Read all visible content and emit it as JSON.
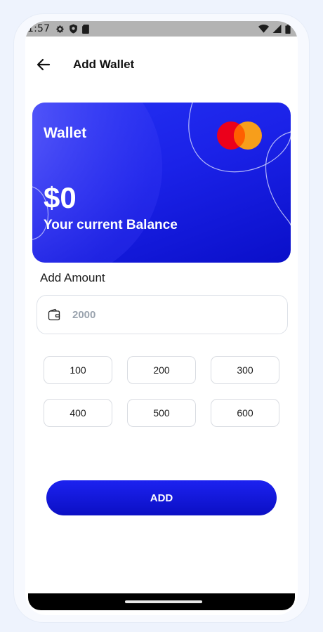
{
  "status_bar": {
    "time": "1:57",
    "left_icons": [
      "gear-icon",
      "shield-icon",
      "sd-card-icon"
    ],
    "right_icons": [
      "wifi-icon",
      "signal-icon",
      "battery-icon"
    ]
  },
  "header": {
    "title": "Add Wallet",
    "back_icon": "arrow-left-icon"
  },
  "card": {
    "label": "Wallet",
    "balance": "$0",
    "caption": "Your current Balance",
    "logo": "mastercard-logo",
    "colors": {
      "gradient_start": "#2431f3",
      "gradient_end": "#0a0fc9",
      "logo_red": "#eb001b",
      "logo_orange": "#f79e1b"
    }
  },
  "amount": {
    "label": "Add Amount",
    "placeholder": "2000",
    "value": "",
    "icon": "wallet-icon"
  },
  "presets": [
    "100",
    "200",
    "300",
    "400",
    "500",
    "600"
  ],
  "actions": {
    "add_label": "ADD"
  },
  "accent": "#1c22f0"
}
